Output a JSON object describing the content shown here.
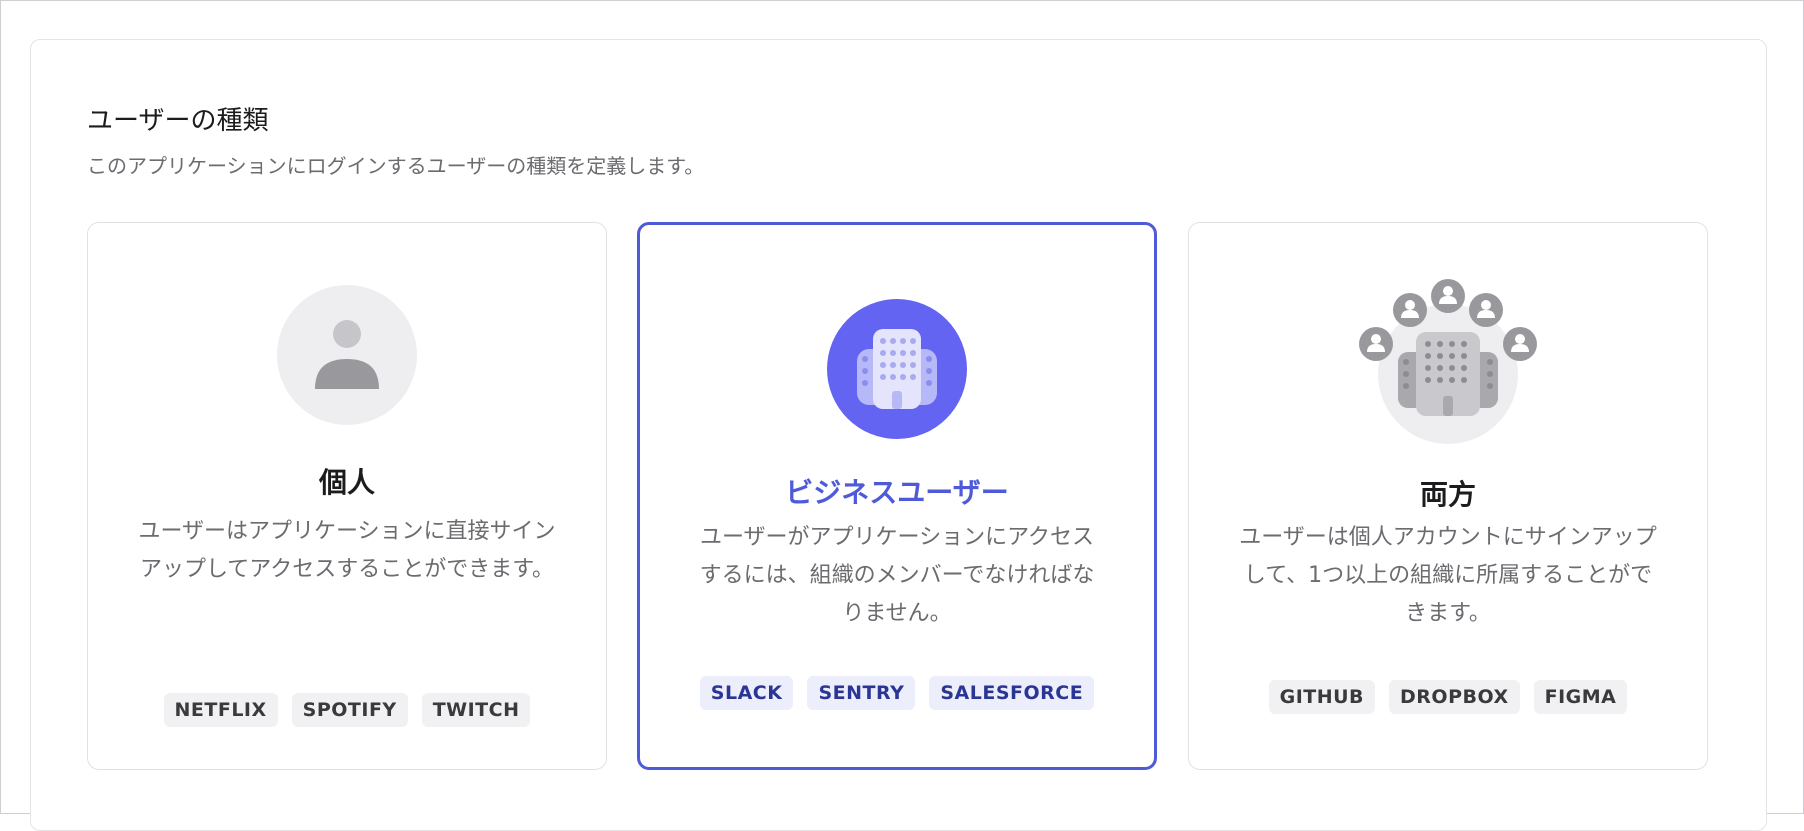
{
  "section": {
    "title": "ユーザーの種類",
    "description": "このアプリケーションにログインするユーザーの種類を定義します。"
  },
  "cards": [
    {
      "title": "個人",
      "description": "ユーザーはアプリケーションに直接サインアップしてアクセスすることができます。",
      "tags": [
        "NETFLIX",
        "SPOTIFY",
        "TWITCH"
      ],
      "icon": "person-icon"
    },
    {
      "title": "ビジネスユーザー",
      "description": "ユーザーがアプリケーションにアクセスするには、組織のメンバーでなければなりません。",
      "tags": [
        "SLACK",
        "SENTRY",
        "SALESFORCE"
      ],
      "icon": "building-icon"
    },
    {
      "title": "両方",
      "description": "ユーザーは個人アカウントにサインアップして、1つ以上の組織に所属することができます。",
      "tags": [
        "GITHUB",
        "DROPBOX",
        "FIGMA"
      ],
      "icon": "building-people-icon"
    }
  ],
  "colors": {
    "accent": "#4f5ad8",
    "icon_bg_selected": "#6364f1",
    "icon_bg_default": "#eeeef0",
    "icon_grey": "#98989d"
  }
}
